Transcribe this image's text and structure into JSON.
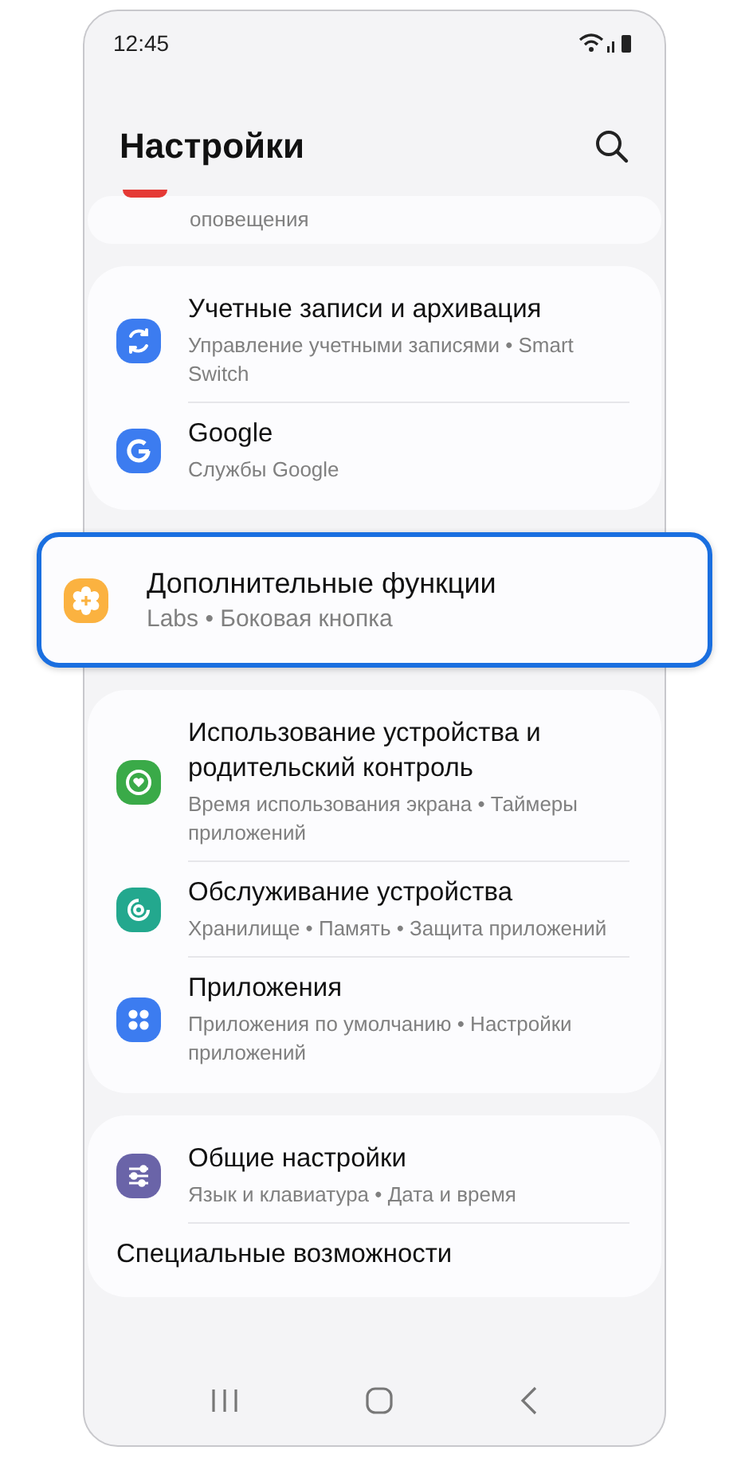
{
  "status_bar": {
    "time": "12:45"
  },
  "header": {
    "title": "Настройки"
  },
  "groups": [
    {
      "kind": "partial",
      "items": [
        {
          "color": "#e53935",
          "subtitle": "оповещения"
        }
      ]
    },
    {
      "kind": "card",
      "items": [
        {
          "color": "#3c7cf0",
          "title": "Учетные записи и архивация",
          "subtitle": "Управление учетными записями • Smart Switch"
        },
        {
          "color": "#3c7cf0",
          "title": "Google",
          "subtitle": "Службы Google"
        }
      ]
    },
    {
      "kind": "highlight",
      "items": [
        {
          "color": "#fbb240",
          "title": "Дополнительные функции",
          "subtitle": "Labs • Боковая кнопка"
        }
      ]
    },
    {
      "kind": "card",
      "items": [
        {
          "color": "#3aaa48",
          "title": "Использование устройства и родительский контроль",
          "subtitle": "Время использования экрана • Таймеры приложений"
        },
        {
          "color": "#23a88e",
          "title": "Обслуживание устройства",
          "subtitle": "Хранилище • Память • Защита приложений"
        },
        {
          "color": "#3c7cf0",
          "title": "Приложения",
          "subtitle": "Приложения по умолчанию • Настройки приложений"
        }
      ]
    },
    {
      "kind": "card",
      "items": [
        {
          "color": "#6a64a8",
          "title": "Общие настройки",
          "subtitle": "Язык и клавиатура • Дата и время"
        },
        {
          "title": "Специальные возможности"
        }
      ]
    }
  ]
}
